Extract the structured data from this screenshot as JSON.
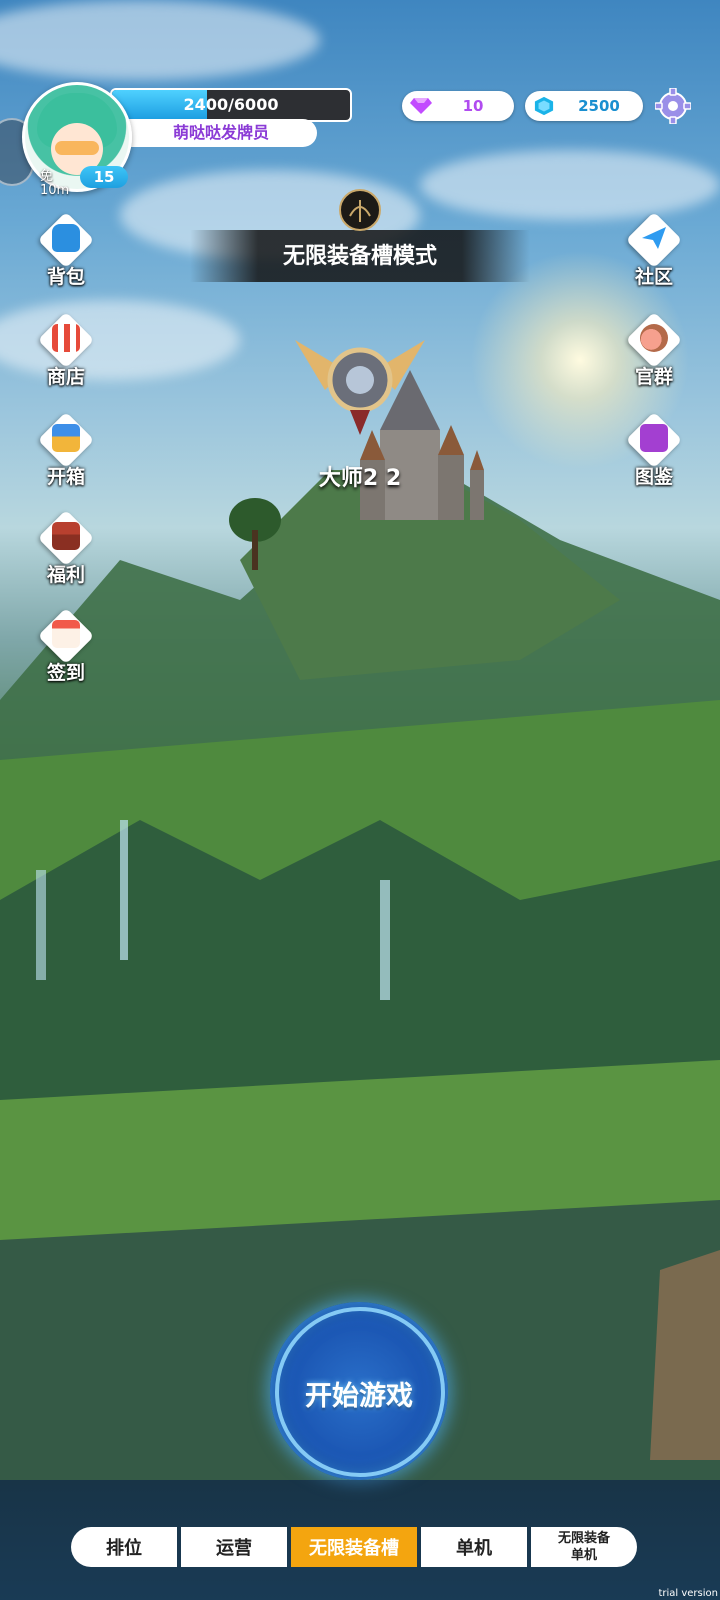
{
  "player": {
    "exp_text": "2400/6000",
    "exp_progress": 0.4,
    "title": "萌哒哒发牌员",
    "level": "15",
    "free_label": "免",
    "free_time": "10m"
  },
  "currencies": {
    "gems": "10",
    "crystals": "2500"
  },
  "mode_banner": {
    "title": "无限装备槽模式"
  },
  "rank": {
    "label": "大师2 2"
  },
  "left_menu": [
    {
      "label": "背包",
      "icon": "backpack-icon"
    },
    {
      "label": "商店",
      "icon": "shop-icon"
    },
    {
      "label": "开箱",
      "icon": "chest-open-icon"
    },
    {
      "label": "福利",
      "icon": "treasure-chest-icon"
    },
    {
      "label": "签到",
      "icon": "calendar-icon"
    }
  ],
  "right_menu": [
    {
      "label": "社区",
      "icon": "paper-plane-icon"
    },
    {
      "label": "官群",
      "icon": "group-icon"
    },
    {
      "label": "图鉴",
      "icon": "book-icon"
    }
  ],
  "start_button": {
    "label": "开始游戏"
  },
  "tabs": [
    {
      "label": "排位"
    },
    {
      "label": "运营"
    },
    {
      "label": "无限装备槽",
      "active": true
    },
    {
      "label": "单机"
    },
    {
      "label": "无限装备\n单机"
    }
  ],
  "watermark": "trial version",
  "colors": {
    "accent": "#f4a50f",
    "exp_fill": "#1c9de0",
    "title_text": "#8b3bd6",
    "level_badge": "#1fa0e0"
  }
}
